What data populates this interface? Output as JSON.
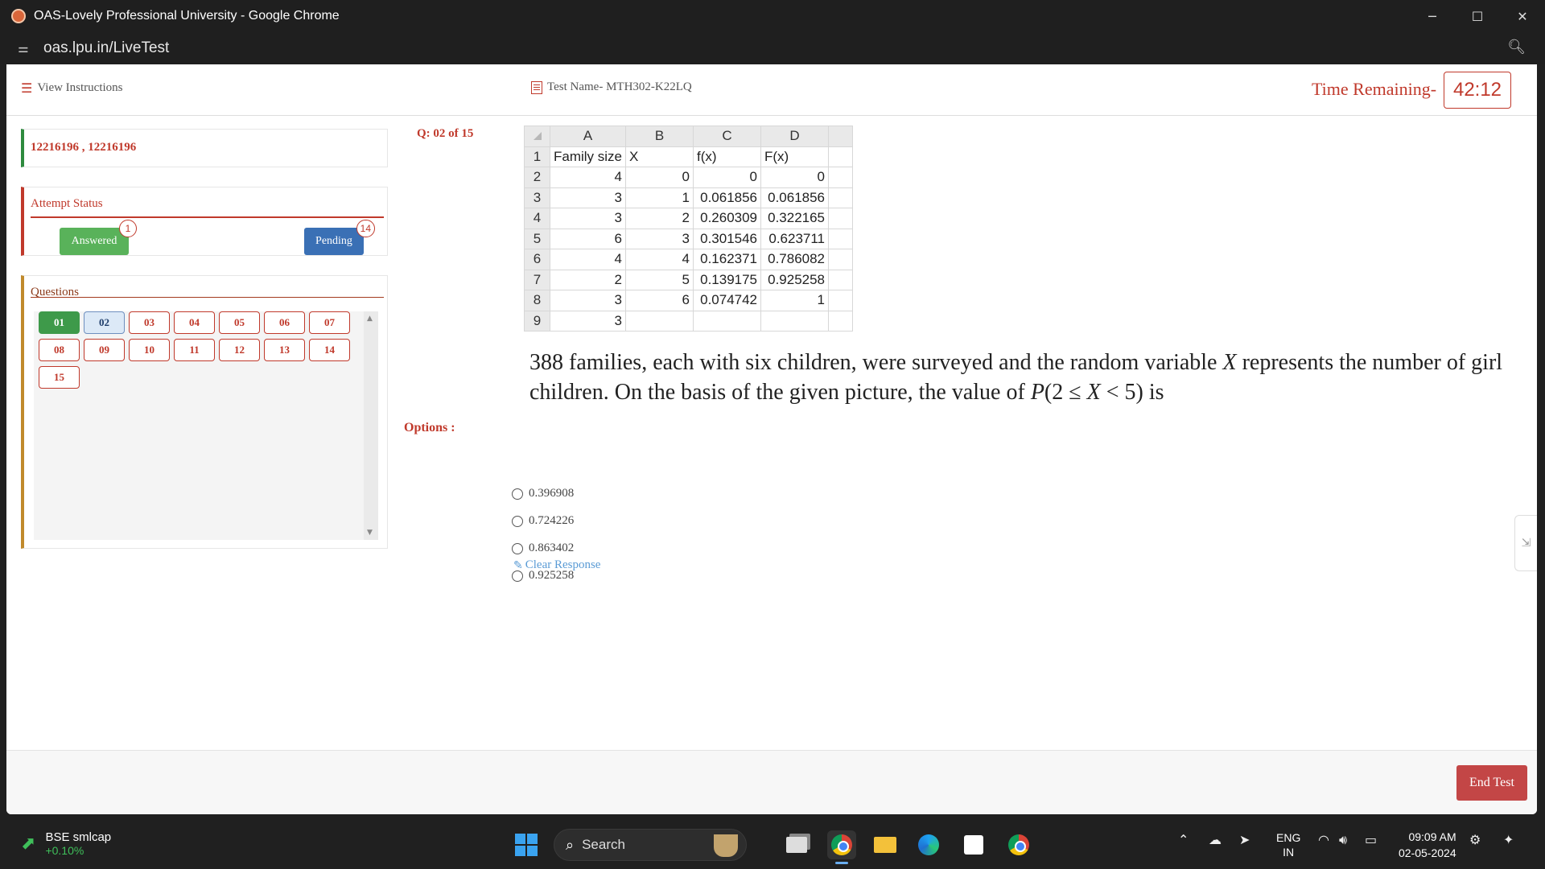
{
  "browser": {
    "window_title": "OAS-Lovely Professional University - Google Chrome",
    "url": "oas.lpu.in/LiveTest"
  },
  "header": {
    "view_instructions": "View Instructions",
    "test_name": "Test Name- MTH302-K22LQ",
    "time_label": "Time Remaining-",
    "time_value": "42:12"
  },
  "user": {
    "id_text": "12216196 , 12216196"
  },
  "attempt_status": {
    "title": "Attempt Status",
    "answered_label": "Answered",
    "answered_count": "1",
    "pending_label": "Pending",
    "pending_count": "14"
  },
  "questions_panel": {
    "title": "Questions",
    "items": [
      "01",
      "02",
      "03",
      "04",
      "05",
      "06",
      "07",
      "08",
      "09",
      "10",
      "11",
      "12",
      "13",
      "14",
      "15"
    ],
    "answered": [
      "01"
    ],
    "current": "02"
  },
  "question": {
    "number": "Q: 02 of 15",
    "text": "388 families, each with six children, were surveyed and the random variable X represents the number of girl children. On the basis of the given picture, the value of P(2 ≤ X < 5) is",
    "text_parts": {
      "p1": "388 families, each with six children, were surveyed and the random variable ",
      "x1": "X",
      "p2": " represents the number of girl children. On the basis of the given picture, the value of ",
      "p_sym": "P",
      "p3": "(2 ≤ ",
      "x2": "X",
      "p4": " < 5) is"
    },
    "table": {
      "col_headers": [
        "A",
        "B",
        "C",
        "D"
      ],
      "row_headers": [
        "1",
        "2",
        "3",
        "4",
        "5",
        "6",
        "7",
        "8",
        "9"
      ],
      "rows": [
        [
          "Family size",
          "X",
          "f(x)",
          "F(x)"
        ],
        [
          "4",
          "0",
          "0",
          "0"
        ],
        [
          "3",
          "1",
          "0.061856",
          "0.061856"
        ],
        [
          "3",
          "2",
          "0.260309",
          "0.322165"
        ],
        [
          "6",
          "3",
          "0.301546",
          "0.623711"
        ],
        [
          "4",
          "4",
          "0.162371",
          "0.786082"
        ],
        [
          "2",
          "5",
          "0.139175",
          "0.925258"
        ],
        [
          "3",
          "6",
          "0.074742",
          "1"
        ],
        [
          "3",
          "",
          "",
          ""
        ]
      ]
    },
    "options_label": "Options :",
    "options": [
      "0.396908",
      "0.724226",
      "0.863402",
      "0.925258"
    ],
    "clear_response": "Clear Response"
  },
  "footer": {
    "end_test": "End Test"
  },
  "taskbar": {
    "widget_name": "BSE smlcap",
    "widget_change": "+0.10%",
    "search_label": "Search",
    "lang_line1": "ENG",
    "lang_line2": "IN",
    "time": "09:09 AM",
    "date": "02-05-2024"
  },
  "colors": {
    "accent_red": "#c0392b",
    "answered_green": "#59b25a",
    "pending_blue": "#3a70b5",
    "end_test_red": "#c34646"
  }
}
